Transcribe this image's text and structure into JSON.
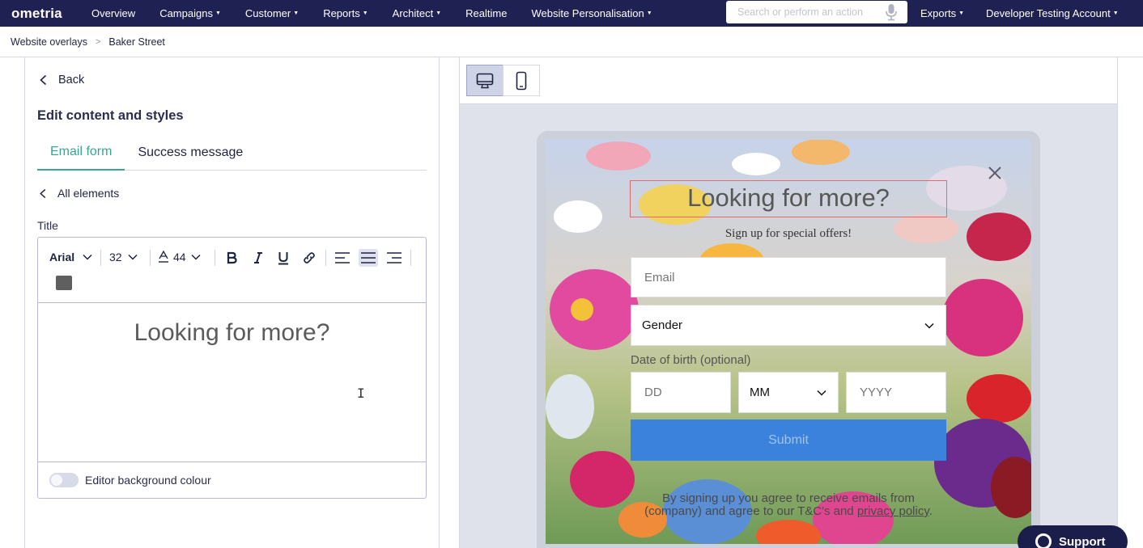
{
  "nav": {
    "logo": "ometria",
    "items": [
      {
        "label": "Overview",
        "caret": false
      },
      {
        "label": "Campaigns",
        "caret": true
      },
      {
        "label": "Customer",
        "caret": true
      },
      {
        "label": "Reports",
        "caret": true
      },
      {
        "label": "Architect",
        "caret": true
      },
      {
        "label": "Realtime",
        "caret": false
      },
      {
        "label": "Website Personalisation",
        "caret": true
      }
    ],
    "search_placeholder": "Search or perform an action",
    "exports": "Exports",
    "account": "Developer Testing Account"
  },
  "breadcrumb": {
    "parent": "Website overlays",
    "separator": ">",
    "current": "Baker Street"
  },
  "left": {
    "back": "Back",
    "heading": "Edit content and styles",
    "tabs": {
      "email_form": "Email form",
      "success": "Success message"
    },
    "all_elements": "All elements",
    "field_label": "Title",
    "toolbar": {
      "font": "Arial",
      "size": "32",
      "line_height": "44",
      "swatch_color": "#5f5f5f"
    },
    "editor_text": "Looking for more?",
    "editor_bg_label": "Editor background colour"
  },
  "modal": {
    "title": "Looking for more?",
    "subtitle": "Sign up for special offers!",
    "email_placeholder": "Email",
    "gender": "Gender",
    "dob_label": "Date of birth (optional)",
    "dd": "DD",
    "mm": "MM",
    "yyyy": "YYYY",
    "submit": "Submit",
    "legal_line1": "By signing up you agree to receive emails from",
    "legal_line2a": "(company) and agree to our T&C's and ",
    "legal_link": "privacy policy",
    "legal_end": "."
  },
  "support": "Support",
  "colors": {
    "nav_bg": "#1f2153",
    "accent": "#3aa592",
    "submit": "#3b82dc"
  }
}
